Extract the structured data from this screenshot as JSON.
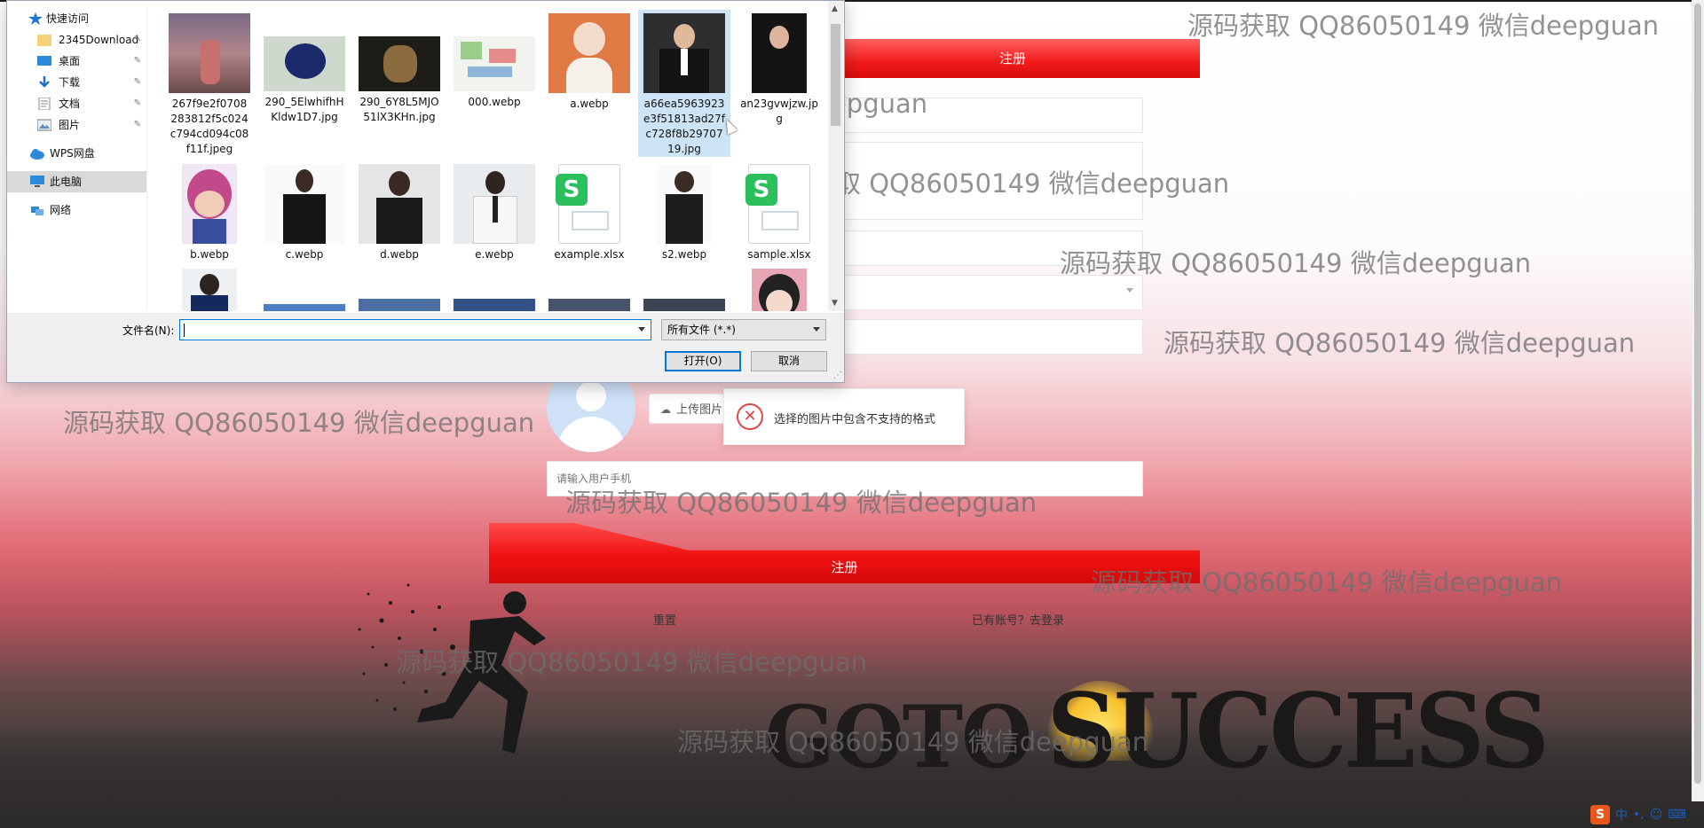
{
  "form": {
    "register_top_label": "注册",
    "register_label": "注册",
    "upload_label": "上传图片",
    "phone_placeholder": "请输入用户手机",
    "reset_link": "重置",
    "login_link": "已有账号？去登录",
    "error_toast": "选择的图片中包含不支持的格式"
  },
  "background": {
    "slogan_goto": "GOTO",
    "slogan_success": "SUCCESS"
  },
  "watermark": "源码获取 QQ86050149 微信deepguan",
  "dialog": {
    "nav": {
      "quick_access": "快速访问",
      "items": [
        {
          "label": "2345Download",
          "icon": "folder-icon",
          "pinned": true
        },
        {
          "label": "桌面",
          "icon": "desktop-icon",
          "pinned": true
        },
        {
          "label": "下载",
          "icon": "download-icon",
          "pinned": true
        },
        {
          "label": "文档",
          "icon": "document-icon",
          "pinned": true
        },
        {
          "label": "图片",
          "icon": "pictures-icon",
          "pinned": true
        }
      ],
      "wps": "WPS网盘",
      "this_pc": "此电脑",
      "network": "网络"
    },
    "files": [
      {
        "name": "267f9e2f0708283812f5c024c794cd094c08f11f.jpeg"
      },
      {
        "name": "290_5ElwhifhHKldw1D7.jpg"
      },
      {
        "name": "290_6Y8L5MJO51lX3KHn.jpg"
      },
      {
        "name": "000.webp"
      },
      {
        "name": "a.webp"
      },
      {
        "name": "a66ea5963923e3f51813ad27fc728f8b2970719.jpg"
      },
      {
        "name": "an23gvwjzw.jpg"
      },
      {
        "name": "b.webp"
      },
      {
        "name": "c.webp"
      },
      {
        "name": "d.webp"
      },
      {
        "name": "e.webp"
      },
      {
        "name": "example.xlsx"
      },
      {
        "name": "s2.webp"
      },
      {
        "name": "sample.xlsx"
      }
    ],
    "filename_label": "文件名(N):",
    "filename_value": "",
    "filetype_value": "所有文件 (*.*)",
    "open_button": "打开(O)",
    "cancel_button": "取消"
  },
  "tray": {
    "ime_logo": "S",
    "ime_lang": "中"
  }
}
